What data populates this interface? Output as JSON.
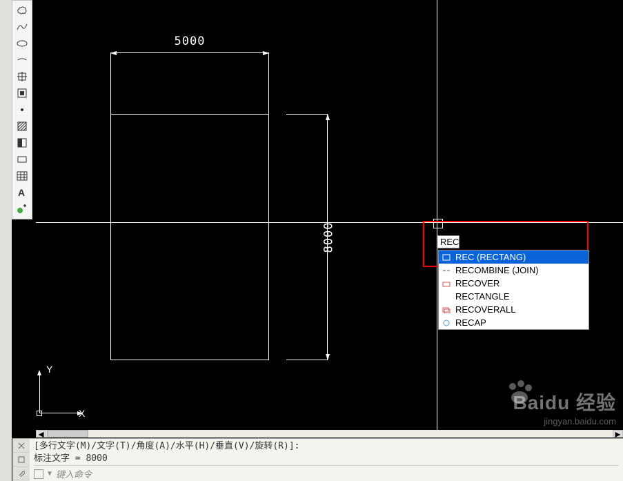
{
  "dimensions": {
    "width": "5000",
    "height": "8000"
  },
  "ucs": {
    "x": "X",
    "y": "Y"
  },
  "command_input": "REC",
  "autocomplete": [
    {
      "label": "REC (RECTANG)",
      "selected": true
    },
    {
      "label": "RECOMBINE (JOIN)",
      "selected": false
    },
    {
      "label": "RECOVER",
      "selected": false
    },
    {
      "label": "RECTANGLE",
      "selected": false
    },
    {
      "label": "RECOVERALL",
      "selected": false
    },
    {
      "label": "RECAP",
      "selected": false
    }
  ],
  "command_history": {
    "line1": "[多行文字(M)/文字(T)/角度(A)/水平(H)/垂直(V)/旋转(R)]:",
    "line2": "标注文字 = 8000"
  },
  "command_prompt": "键入命令",
  "watermark": {
    "brand": "Baidu 经验",
    "url": "jingyan.baidu.com"
  }
}
